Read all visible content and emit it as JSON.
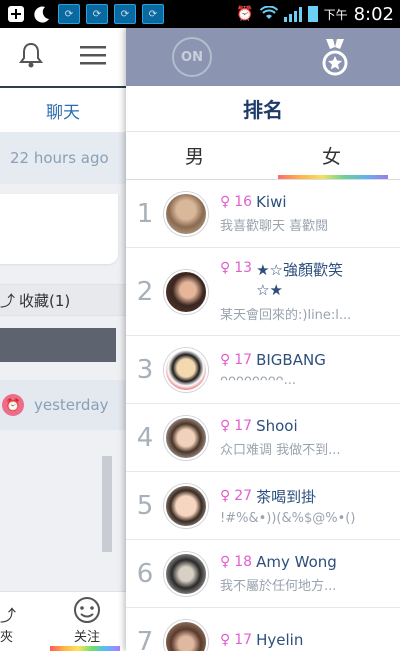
{
  "statusbar": {
    "period": "下午",
    "time": "8:02"
  },
  "left_panel": {
    "chat_tab": "聊天",
    "time_label": "22 hours ago",
    "favorite_label": "收藏(1)",
    "yesterday_label": "yesterday",
    "bottom_tab_1": "夾",
    "bottom_tab_2": "关注"
  },
  "header": {
    "on_label": "ON"
  },
  "ranking": {
    "title": "排名",
    "tab_male": "男",
    "tab_female": "女",
    "rows": [
      {
        "rank": "1",
        "age": "16",
        "name": "Kiwi",
        "status": "我喜歡聊天 喜歡閱"
      },
      {
        "rank": "2",
        "age": "13",
        "name": "★☆強顏歡笑☆★",
        "status": "某天會回來的:)line:l..."
      },
      {
        "rank": "3",
        "age": "17",
        "name": "BIGBANG",
        "status": "ᴖᴖᴖᴖᴖᴖᴖᴖ..."
      },
      {
        "rank": "4",
        "age": "17",
        "name": "Shooi",
        "status": "众口难调 我做不到..."
      },
      {
        "rank": "5",
        "age": "27",
        "name": "茶喝到掛",
        "status": "!#%&•))(&%$@%•()"
      },
      {
        "rank": "6",
        "age": "18",
        "name": "Amy Wong",
        "status": "我不屬於任何地方..."
      },
      {
        "rank": "7",
        "age": "17",
        "name": "Hyelin",
        "status": ""
      }
    ]
  },
  "colors": {
    "header_bg": "#8b95b1",
    "accent_female": "#e25fcf",
    "title_color": "#1e3a68"
  }
}
